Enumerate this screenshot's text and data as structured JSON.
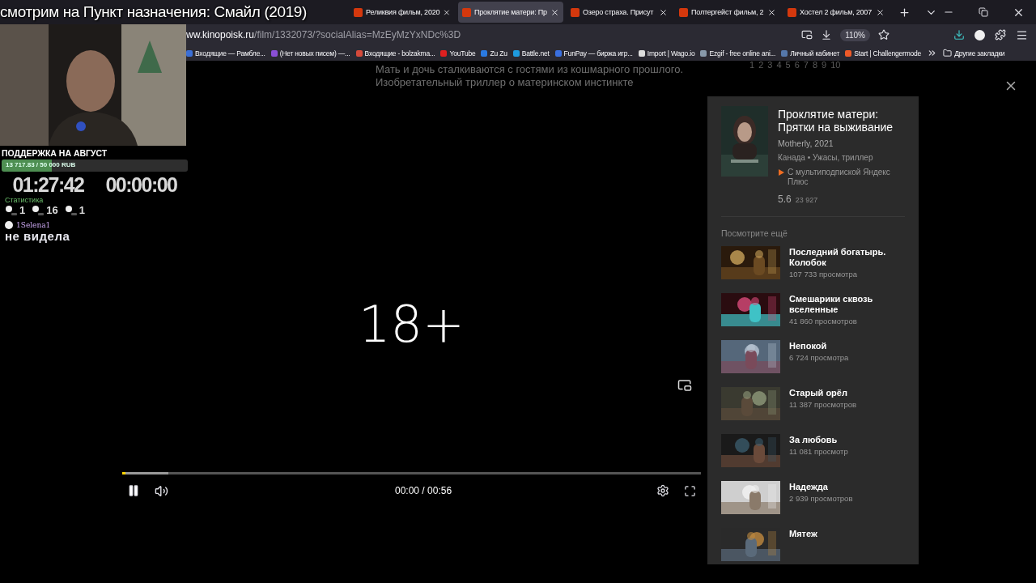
{
  "browser": {
    "tabs": [
      {
        "title": "Реликвия фильм, 2020",
        "selected": false
      },
      {
        "title": "Проклятие матери: Пр",
        "selected": true
      },
      {
        "title": "Озеро страха. Присут",
        "selected": false
      },
      {
        "title": "Полтергейст фильм, 2",
        "selected": false
      },
      {
        "title": "Хостел 2 фильм, 2007",
        "selected": false
      }
    ],
    "url_host": "ww.kinopoisk.ru",
    "url_path": "/film/1332073/?socialAlias=MzEyMzYxNDc%3D",
    "zoom": "110%",
    "bookmarks": [
      {
        "label": "Входящие — Рамбле...",
        "color": "#3b6fd6"
      },
      {
        "label": "(Нет новых писем) —...",
        "color": "#8a4fd6"
      },
      {
        "label": "Входящие - bolzakma...",
        "color": "#d64a3b"
      },
      {
        "label": "YouTube",
        "color": "#e02020"
      },
      {
        "label": "Zu Zu",
        "color": "#2a7ae2"
      },
      {
        "label": "Battle.net",
        "color": "#1e9be0"
      },
      {
        "label": "FunPay — биржа игр...",
        "color": "#3a6fe0"
      },
      {
        "label": "Import | Wago.io",
        "color": "#dddddd"
      },
      {
        "label": "Ezgif - free online ani...",
        "color": "#8899aa"
      },
      {
        "label": "Личный кабинет",
        "color": "#5577aa"
      },
      {
        "label": "Start | Challengermode",
        "color": "#f05a28"
      }
    ],
    "other_bookmarks": "Другие закладки"
  },
  "page": {
    "description": [
      "Мать и дочь сталкиваются с гостями из кошмарного прошлого.",
      "Изобретательный триллер о материнском инстинкте"
    ],
    "rating_scale": [
      "1",
      "2",
      "3",
      "4",
      "5",
      "6",
      "7",
      "8",
      "9",
      "10"
    ]
  },
  "player": {
    "age": "18+",
    "paused": false,
    "progress": {
      "level": 0.005
    },
    "buffer": {
      "level": 0.08
    },
    "time": "00:00 / 00:56"
  },
  "panel": {
    "title": "Проклятие матери: Прятки на выживание",
    "original": "Motherly, 2021",
    "meta": "Канада • Ужасы, триллер",
    "subscription": "С мультиподпиской Яндекс Плюс",
    "rating": "5.6",
    "votes": "23 927",
    "more_title": "Посмотрите ещё",
    "items": [
      {
        "title": "Последний богатырь. Колобок",
        "views": "107 733 просмотра"
      },
      {
        "title": "Смешарики сквозь вселенные",
        "views": "41 860 просмотров"
      },
      {
        "title": "Непокой",
        "views": "6 724 просмотра"
      },
      {
        "title": "Старый орёл",
        "views": "11 387 просмотров"
      },
      {
        "title": "За любовь",
        "views": "11 081 просмотр"
      },
      {
        "title": "Надежда",
        "views": "2 939 просмотров"
      },
      {
        "title": "Мятеж"
      }
    ]
  },
  "stream_overlay": {
    "title": "смотрим на Пункт назначения: Смайл (2019)",
    "support": {
      "title": "ПОДДЕРЖКА НА АВГУСТ",
      "amount": "13 717.83 / 50 000 RUB",
      "level": 0.27
    },
    "timers": [
      "01:27:42",
      "00:00:00"
    ],
    "stats_title": "Статистика",
    "stats": [
      "1",
      "16",
      "1"
    ],
    "chat": {
      "user": "1Selena1",
      "message": "не видела"
    }
  }
}
